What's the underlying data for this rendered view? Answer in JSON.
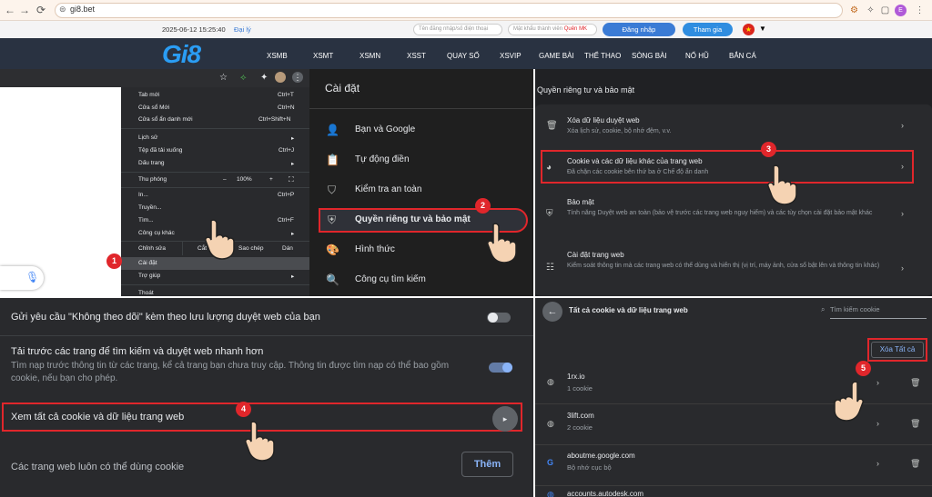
{
  "browser": {
    "url": "gi8.bet"
  },
  "site": {
    "datetime": "2025-06-12 15:25:40",
    "agent": "Đại lý",
    "login_placeholder": "Tên đăng nhập/số điện thoại",
    "password_placeholder": "Mật khẩu thành viên",
    "forgot": "Quên MK",
    "login_btn": "Đăng nhập",
    "join_btn": "Tham gia",
    "logo": "Gi8",
    "nav": [
      "XSMB",
      "XSMT",
      "XSMN",
      "XSST",
      "QUAY SỐ",
      "XSVIP",
      "GAME BÀI",
      "THỂ THAO",
      "SÒNG BÀI",
      "NỔ HŨ",
      "BẮN CÁ"
    ]
  },
  "chrome_menu": {
    "items": [
      {
        "label": "Tab mới",
        "shortcut": "Ctrl+T"
      },
      {
        "label": "Cửa sổ Mới",
        "shortcut": "Ctrl+N"
      },
      {
        "label": "Cửa sổ ẩn danh mới",
        "shortcut": "Ctrl+Shift+N"
      },
      {
        "label": "Lịch sử",
        "shortcut": "▸"
      },
      {
        "label": "Tệp đã tải xuống",
        "shortcut": "Ctrl+J"
      },
      {
        "label": "Dấu trang",
        "shortcut": "▸"
      },
      {
        "label": "Thu phóng",
        "shortcut": ""
      },
      {
        "label": "In...",
        "shortcut": "Ctrl+P"
      },
      {
        "label": "Truyền...",
        "shortcut": ""
      },
      {
        "label": "Tìm...",
        "shortcut": "Ctrl+F"
      },
      {
        "label": "Công cụ khác",
        "shortcut": "▸"
      }
    ],
    "zoom_minus": "–",
    "zoom_value": "100%",
    "zoom_plus": "+",
    "edit_label": "Chỉnh sửa",
    "cut": "Cắt",
    "copy": "Sao chép",
    "paste": "Dán",
    "settings": "Cài đặt",
    "help": "Trợ giúp",
    "exit": "Thoát"
  },
  "settings": {
    "title": "Cài đặt",
    "items": [
      {
        "label": "Bạn và Google",
        "icon": "person-icon"
      },
      {
        "label": "Tự động điền",
        "icon": "clipboard-icon"
      },
      {
        "label": "Kiểm tra an toàn",
        "icon": "shield-check-icon"
      },
      {
        "label": "Quyền riêng tư và bảo mật",
        "icon": "shield-icon"
      },
      {
        "label": "Hình thức",
        "icon": "palette-icon"
      },
      {
        "label": "Công cụ tìm kiếm",
        "icon": "search-icon"
      }
    ]
  },
  "privacy": {
    "title": "Quyền riêng tư và bảo mật",
    "rows": [
      {
        "title": "Xóa dữ liệu duyệt web",
        "sub": "Xóa lịch sử, cookie, bộ nhớ đệm, v.v."
      },
      {
        "title": "Cookie và các dữ liệu khác của trang web",
        "sub": "Đã chặn các cookie bên thứ ba ở Chế độ ẩn danh"
      },
      {
        "title": "Bảo mật",
        "sub": "Tính năng Duyệt web an toàn (bảo vệ trước các trang web nguy hiểm) và các tùy chọn cài đặt bảo mật khác"
      },
      {
        "title": "Cài đặt trang web",
        "sub": "Kiểm soát thông tin mà các trang web có thể dùng và hiển thị (vị trí, máy ảnh, cửa sổ bật lên và thông tin khác)"
      }
    ]
  },
  "cookies_page": {
    "title": "Tất cả cookie và dữ liệu trang web",
    "search_placeholder": "Tìm kiếm cookie",
    "clear_all": "Xóa Tất cả",
    "sites": [
      {
        "name": "1rx.io",
        "sub": "1 cookie"
      },
      {
        "name": "3lift.com",
        "sub": "2 cookie"
      },
      {
        "name": "aboutme.google.com",
        "sub": "Bộ nhớ cục bộ"
      },
      {
        "name": "accounts.autodesk.com",
        "sub": ""
      }
    ]
  },
  "cookie_settings": {
    "dnt": "Gửi yêu cầu \"Không theo dõi\" kèm theo lưu lượng duyệt web của bạn",
    "preload": "Tải trước các trang để tìm kiếm và duyệt web nhanh hơn",
    "preload_sub": "Tìm nạp trước thông tin từ các trang, kể cả trang bạn chưa truy cập. Thông tin được tìm nạp có thể bao gồm cookie, nếu bạn cho phép.",
    "see_all": "Xem tất cả cookie và dữ liệu trang web",
    "always_allow": "Các trang web luôn có thể dùng cookie",
    "add_btn": "Thêm"
  },
  "steps": [
    "1",
    "2",
    "3",
    "4",
    "5"
  ],
  "colors": {
    "highlight": "#e0262b",
    "accent": "#8ab4f8",
    "brand": "#2a9df4"
  }
}
